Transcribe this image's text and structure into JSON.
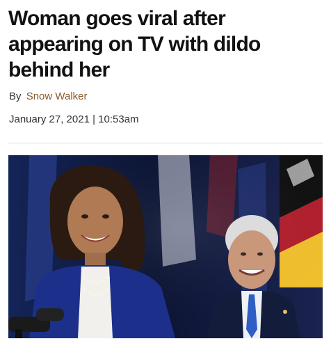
{
  "article": {
    "headline": "Woman goes viral after appearing on TV with dildo behind her",
    "byline_prefix": "By",
    "author": "Snow Walker",
    "date": "January 27, 2021",
    "date_separator": "|",
    "time": "10:53am"
  },
  "photo": {
    "background_color": "#0c1430",
    "flag_colors": [
      "#b21f2d",
      "#f2c12e",
      "#1f3a8a",
      "#ffffff"
    ]
  }
}
